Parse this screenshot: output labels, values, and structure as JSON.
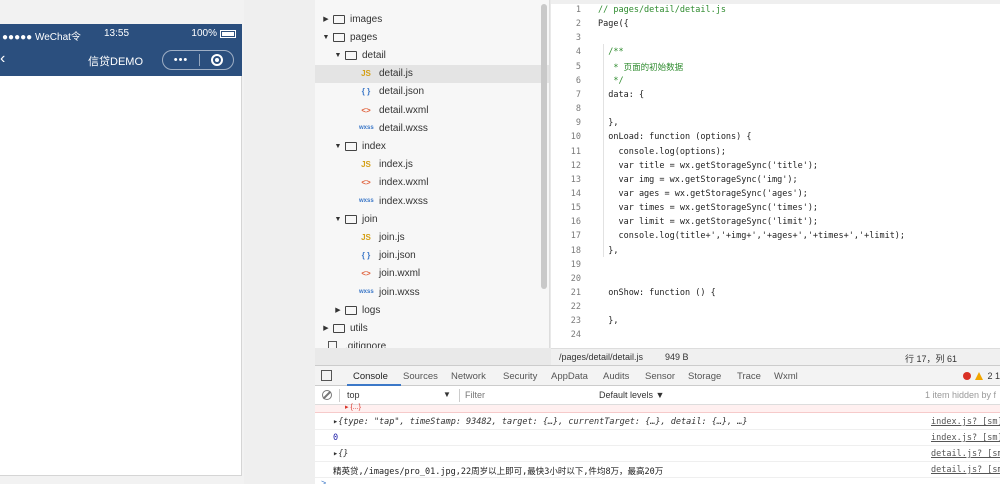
{
  "simulator": {
    "carrier": "●●●●● WeChat令",
    "time": "13:55",
    "battery": "100%",
    "nav_back": "‹",
    "nav_title": "信贷DEMO",
    "more": "•••"
  },
  "file_tree": [
    {
      "label": "images",
      "type": "folder",
      "state": "closed",
      "indent": 0
    },
    {
      "label": "pages",
      "type": "folder",
      "state": "open",
      "indent": 0
    },
    {
      "label": "detail",
      "type": "folder",
      "state": "open",
      "indent": 1
    },
    {
      "label": "detail.js",
      "type": "js",
      "indent": 2,
      "selected": true,
      "icon": "JS"
    },
    {
      "label": "detail.json",
      "type": "json",
      "indent": 2,
      "icon": "{ }"
    },
    {
      "label": "detail.wxml",
      "type": "wxml",
      "indent": 2,
      "icon": "<>"
    },
    {
      "label": "detail.wxss",
      "type": "wxss",
      "indent": 2,
      "icon": "wxss"
    },
    {
      "label": "index",
      "type": "folder",
      "state": "open",
      "indent": 1
    },
    {
      "label": "index.js",
      "type": "js",
      "indent": 2,
      "icon": "JS"
    },
    {
      "label": "index.wxml",
      "type": "wxml",
      "indent": 2,
      "icon": "<>"
    },
    {
      "label": "index.wxss",
      "type": "wxss",
      "indent": 2,
      "icon": "wxss"
    },
    {
      "label": "join",
      "type": "folder",
      "state": "open",
      "indent": 1
    },
    {
      "label": "join.js",
      "type": "js",
      "indent": 2,
      "icon": "JS"
    },
    {
      "label": "join.json",
      "type": "json",
      "indent": 2,
      "icon": "{ }"
    },
    {
      "label": "join.wxml",
      "type": "wxml",
      "indent": 2,
      "icon": "<>"
    },
    {
      "label": "join.wxss",
      "type": "wxss",
      "indent": 2,
      "icon": "wxss"
    },
    {
      "label": "logs",
      "type": "folder",
      "state": "closed",
      "indent": 1
    },
    {
      "label": "utils",
      "type": "folder",
      "state": "closed",
      "indent": 0
    },
    {
      "label": ".gitignore",
      "type": "file",
      "indent": 0
    },
    {
      "label": "README.md",
      "type": "file",
      "indent": 0
    }
  ],
  "editor": {
    "lines": [
      {
        "n": "1",
        "text": "// pages/detail/detail.js",
        "style": "comment"
      },
      {
        "n": "2",
        "text": "Page({",
        "style": "plain"
      },
      {
        "n": "3",
        "text": "",
        "style": "plain"
      },
      {
        "n": "4",
        "text": "  /**",
        "style": "comment"
      },
      {
        "n": "5",
        "text": "   * 页面的初始数据",
        "style": "comment"
      },
      {
        "n": "6",
        "text": "   */",
        "style": "comment"
      },
      {
        "n": "7",
        "text": "  data: {",
        "style": "plain"
      },
      {
        "n": "8",
        "text": "",
        "style": "plain"
      },
      {
        "n": "9",
        "text": "  },",
        "style": "plain"
      },
      {
        "n": "10",
        "text": "  onLoad: function (options) {",
        "style": "plain"
      },
      {
        "n": "11",
        "text": "    console.log(options);",
        "style": "plain"
      },
      {
        "n": "12",
        "text": "    var title = wx.getStorageSync('title');",
        "style": "plain"
      },
      {
        "n": "13",
        "text": "    var img = wx.getStorageSync('img');",
        "style": "plain"
      },
      {
        "n": "14",
        "text": "    var ages = wx.getStorageSync('ages');",
        "style": "plain"
      },
      {
        "n": "15",
        "text": "    var times = wx.getStorageSync('times');",
        "style": "plain"
      },
      {
        "n": "16",
        "text": "    var limit = wx.getStorageSync('limit');",
        "style": "plain"
      },
      {
        "n": "17",
        "text": "    console.log(title+','+img+','+ages+','+times+','+limit);",
        "style": "plain"
      },
      {
        "n": "18",
        "text": "  },",
        "style": "plain"
      },
      {
        "n": "19",
        "text": "",
        "style": "plain"
      },
      {
        "n": "20",
        "text": "",
        "style": "plain"
      },
      {
        "n": "21",
        "text": "  onShow: function () {",
        "style": "plain"
      },
      {
        "n": "22",
        "text": "",
        "style": "plain"
      },
      {
        "n": "23",
        "text": "  },",
        "style": "plain"
      },
      {
        "n": "24",
        "text": "",
        "style": "plain"
      }
    ],
    "status_path": "/pages/detail/detail.js",
    "status_size": "949 B",
    "status_pos": "行 17，列 61"
  },
  "devtools": {
    "tabs": [
      "Console",
      "Sources",
      "Network",
      "Security",
      "AppData",
      "Audits",
      "Sensor",
      "Storage",
      "Trace",
      "Wxml"
    ],
    "badges": "2  1",
    "context": "top",
    "filter_placeholder": "Filter",
    "levels": "Default levels ▼",
    "hidden_info": "1 item hidden by f",
    "error_line": "▸ {...}",
    "logs": [
      {
        "msg": "▸{type: \"tap\", timeStamp: 93482, target: {…}, currentTarget: {…}, detail: {…}, …}",
        "src": "index.js? [sm]",
        "kind": "italic"
      },
      {
        "msg": "0",
        "src": "index.js? [sm]",
        "kind": "num"
      },
      {
        "msg": "▸{}",
        "src": "detail.js? [sm]",
        "kind": "italic"
      },
      {
        "msg": "精英贷,/images/pro_01.jpg,22周岁以上即可,最快3小时以下,件均8万，最高20万",
        "src": "detail.js? [sm]",
        "kind": "text"
      }
    ],
    "prompt": ">"
  }
}
